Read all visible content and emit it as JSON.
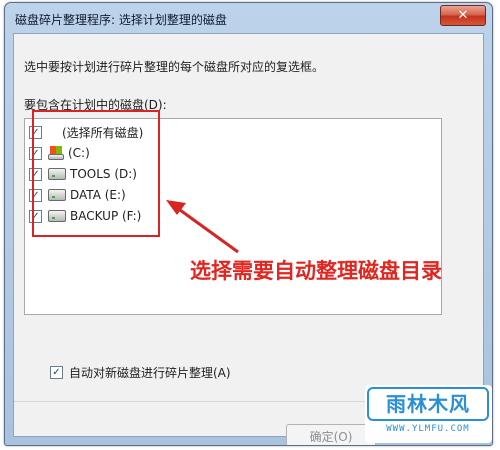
{
  "window": {
    "title": "磁盘碎片整理程序: 选择计划整理的磁盘",
    "close_glyph": "✕"
  },
  "description": "选中要按计划进行碎片整理的每个磁盘所对应的复选框。",
  "include_label": "要包含在计划中的磁盘(D):",
  "disks": [
    {
      "label": "(选择所有磁盘)",
      "checked": true,
      "icon": "none"
    },
    {
      "label": "(C:)",
      "checked": true,
      "icon": "windows-drive-icon"
    },
    {
      "label": "TOOLS (D:)",
      "checked": true,
      "icon": "drive-icon"
    },
    {
      "label": "DATA (E:)",
      "checked": true,
      "icon": "drive-icon"
    },
    {
      "label": "BACKUP (F:)",
      "checked": true,
      "icon": "drive-icon"
    }
  ],
  "check_glyph": "✓",
  "auto_defrag": {
    "label": "自动对新磁盘进行碎片整理(A)",
    "checked": true
  },
  "buttons": {
    "ok": "确定(O)"
  },
  "annotation": {
    "text": "选择需要自动整理磁盘目录",
    "color": "#e32520"
  },
  "watermark": {
    "title": "雨林木风",
    "url": "WWW.YLMFU.COM"
  },
  "colors": {
    "accent": "#2b8fd6",
    "highlight": "#d92424"
  }
}
